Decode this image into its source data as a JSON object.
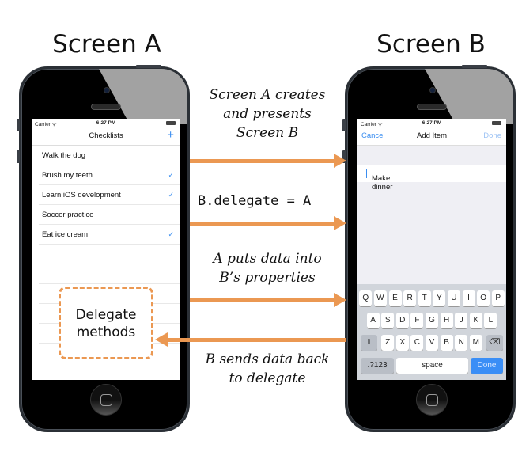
{
  "titles": {
    "screen_a": "Screen A",
    "screen_b": "Screen B"
  },
  "status_bar": {
    "carrier": "Carrier ᯤ",
    "time": "6:27 PM"
  },
  "screen_a": {
    "nav_title": "Checklists",
    "add_icon": "+",
    "items": [
      {
        "label": "Walk the dog",
        "checked": false
      },
      {
        "label": "Brush my teeth",
        "checked": true
      },
      {
        "label": "Learn iOS development",
        "checked": true
      },
      {
        "label": "Soccer practice",
        "checked": false
      },
      {
        "label": "Eat ice cream",
        "checked": true
      }
    ],
    "checkmark": "✓"
  },
  "screen_b": {
    "cancel_label": "Cancel",
    "nav_title": "Add Item",
    "done_label": "Done",
    "text_field_value": "Make dinner",
    "keyboard": {
      "row1": [
        "Q",
        "W",
        "E",
        "R",
        "T",
        "Y",
        "U",
        "I",
        "O",
        "P"
      ],
      "row2": [
        "A",
        "S",
        "D",
        "F",
        "G",
        "H",
        "J",
        "K",
        "L"
      ],
      "row3": [
        "Z",
        "X",
        "C",
        "V",
        "B",
        "N",
        "M"
      ],
      "shift": "⇧",
      "delete": "⌫",
      "numbers": ".?123",
      "space": "space",
      "done": "Done"
    }
  },
  "arrows": {
    "creates": "Screen A creates and presents Screen B",
    "creates_lines": [
      "Screen A creates",
      "and presents",
      "Screen B"
    ],
    "delegate_assign": "B.delegate = A",
    "puts_data_lines": [
      "A puts data into",
      "B’s properties"
    ],
    "sends_back_lines": [
      "B sends data back",
      "to delegate"
    ]
  },
  "delegate_box": {
    "lines": [
      "Delegate",
      "methods"
    ]
  },
  "colors": {
    "arrow": "#eb9852",
    "ios_blue": "#3b8ef0"
  }
}
